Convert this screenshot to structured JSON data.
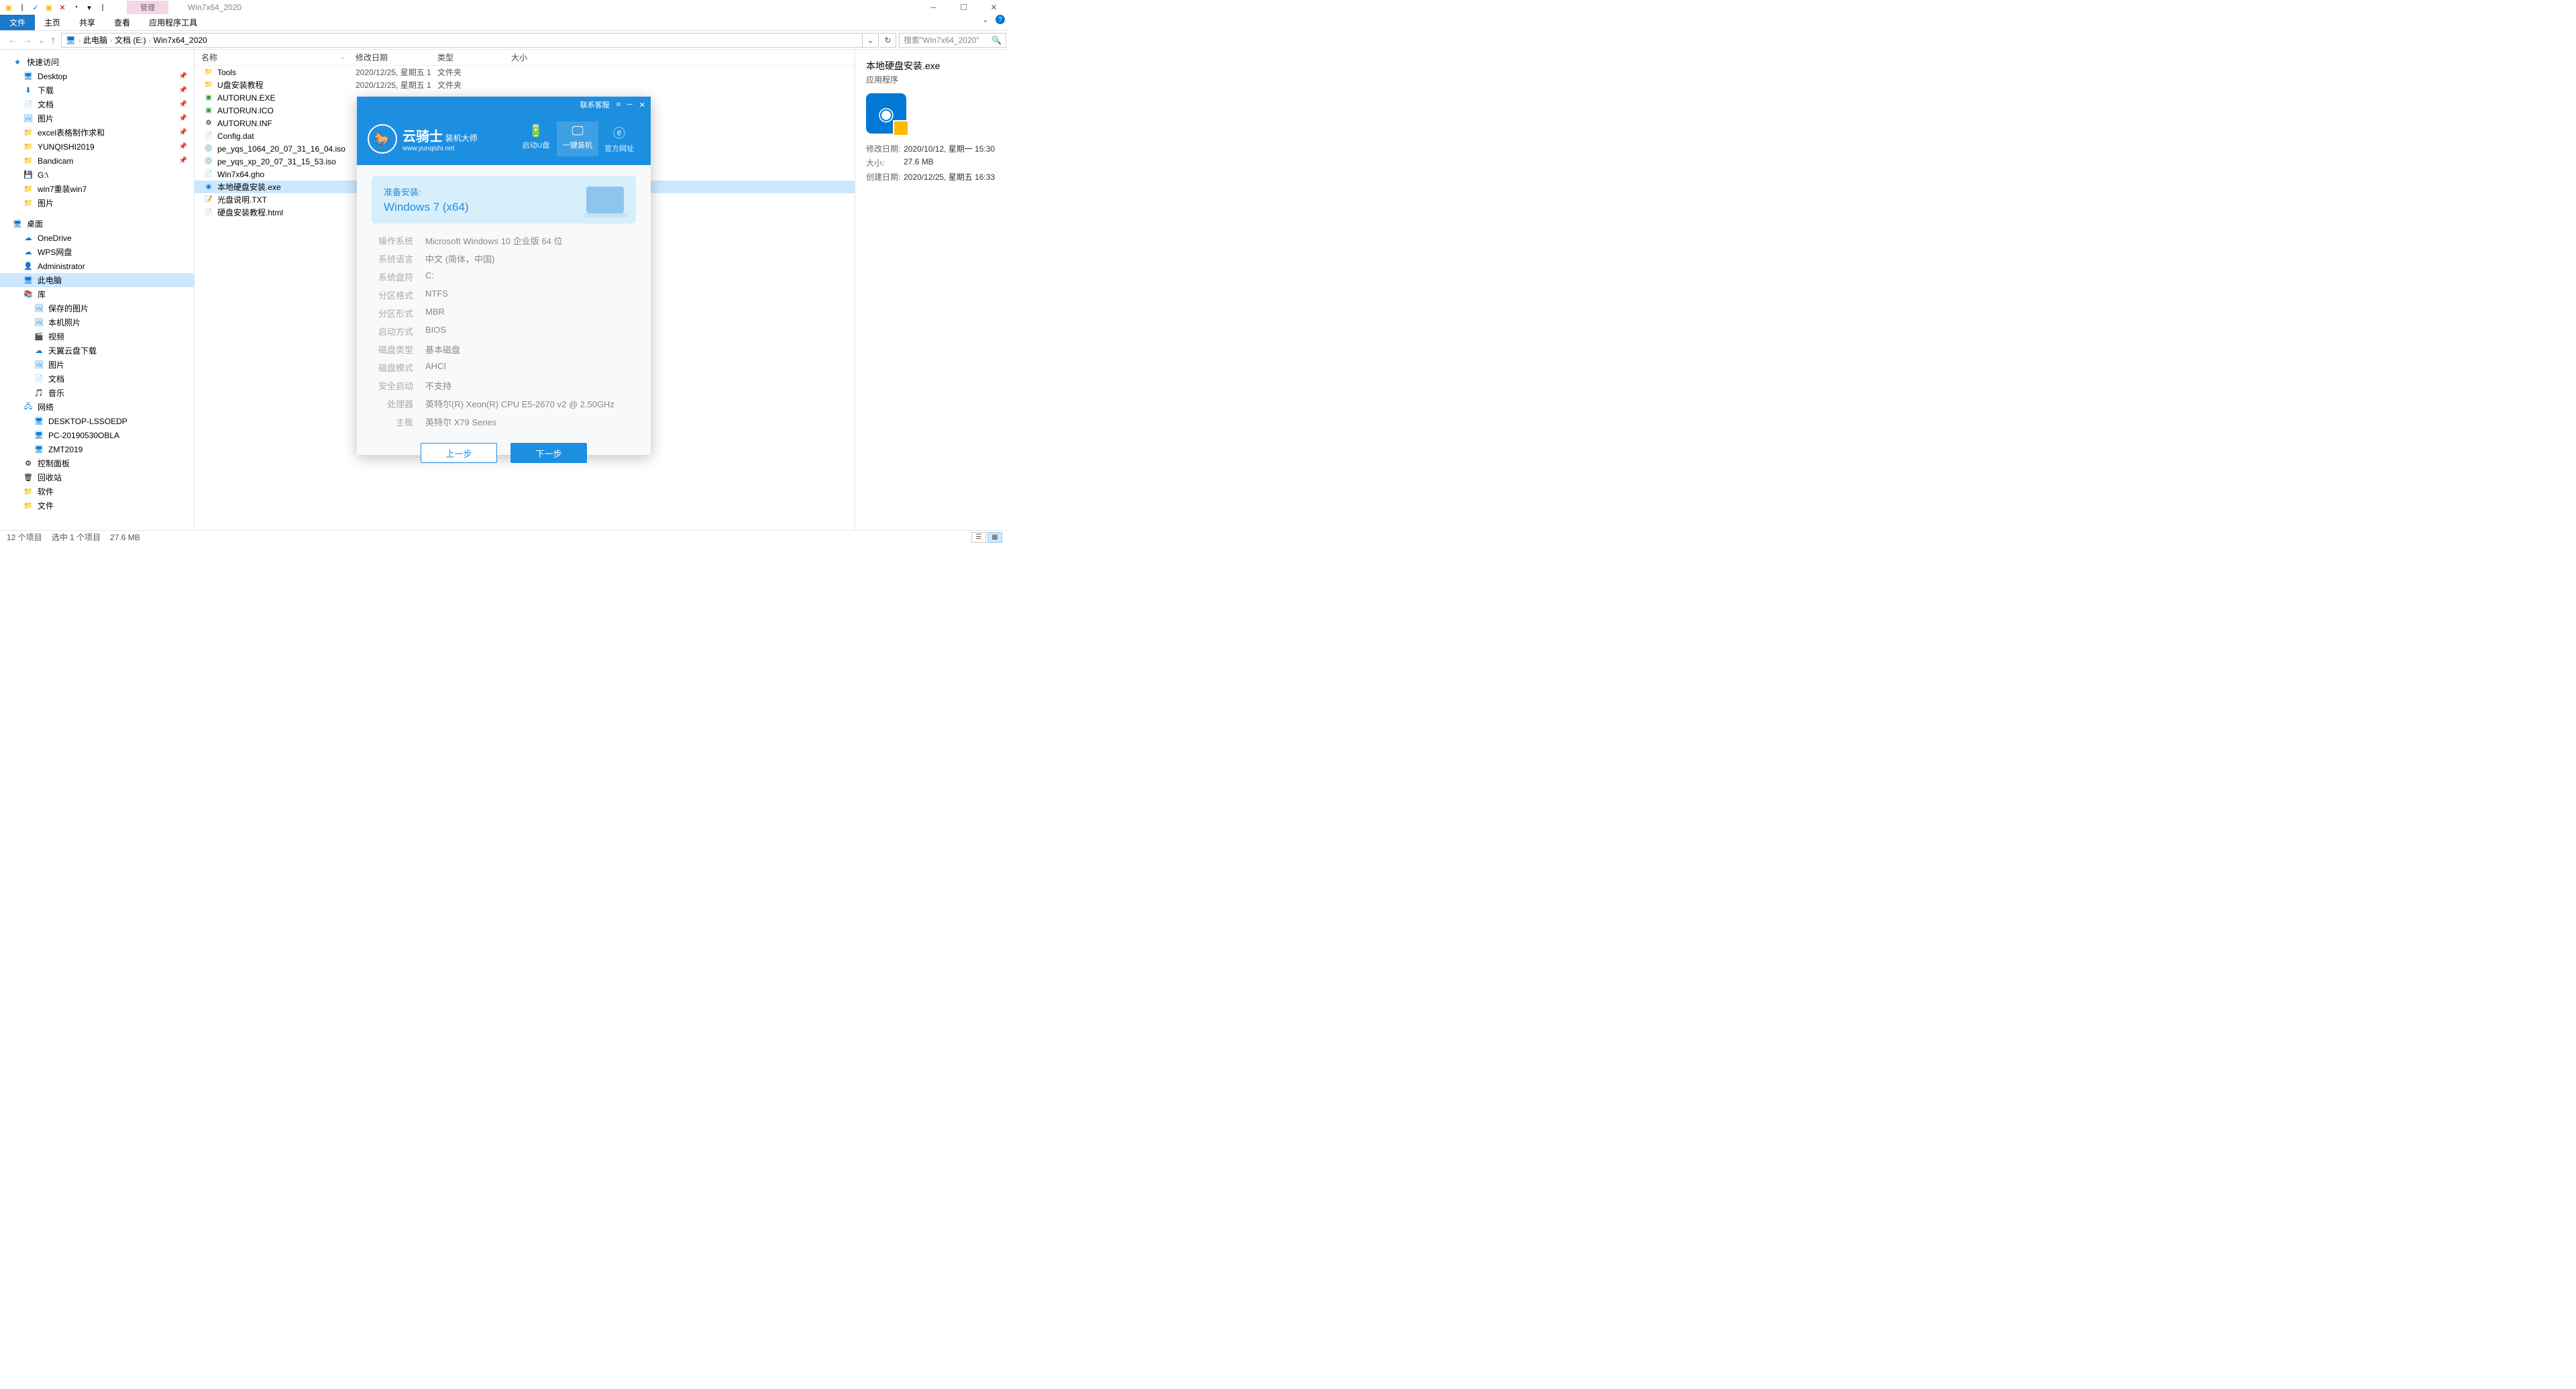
{
  "window": {
    "manage_tab": "管理",
    "title": "Win7x64_2020"
  },
  "ribbon": {
    "tabs": [
      "文件",
      "主页",
      "共享",
      "查看",
      "应用程序工具"
    ],
    "active": 0
  },
  "breadcrumbs": [
    "此电脑",
    "文档 (E:)",
    "Win7x64_2020"
  ],
  "search_placeholder": "搜索\"Win7x64_2020\"",
  "columns": {
    "name": "名称",
    "date": "修改日期",
    "type": "类型",
    "size": "大小"
  },
  "sidebar": {
    "quick": {
      "label": "快速访问",
      "items": [
        {
          "icon": "🖥",
          "iconClass": "blue-i",
          "label": "Desktop",
          "pin": true
        },
        {
          "icon": "⬇",
          "iconClass": "blue-i",
          "label": "下载",
          "pin": true
        },
        {
          "icon": "📄",
          "iconClass": "blue-i",
          "label": "文档",
          "pin": true
        },
        {
          "icon": "🖼",
          "iconClass": "blue-i",
          "label": "图片",
          "pin": true
        },
        {
          "icon": "📁",
          "iconClass": "folder-y",
          "label": "excel表格制作求和",
          "pin": true
        },
        {
          "icon": "📁",
          "iconClass": "folder-y",
          "label": "YUNQISHI2019",
          "pin": true
        },
        {
          "icon": "📁",
          "iconClass": "folder-y",
          "label": "Bandicam",
          "pin": true
        },
        {
          "icon": "💾",
          "iconClass": "",
          "label": "G:\\",
          "pin": false
        },
        {
          "icon": "📁",
          "iconClass": "folder-y",
          "label": "win7重装win7",
          "pin": false
        },
        {
          "icon": "📁",
          "iconClass": "folder-y",
          "label": "图片",
          "pin": false
        }
      ]
    },
    "desktop": {
      "label": "桌面",
      "items": [
        {
          "icon": "☁",
          "iconClass": "blue-i",
          "label": "OneDrive"
        },
        {
          "icon": "☁",
          "iconClass": "blue-i",
          "label": "WPS网盘"
        },
        {
          "icon": "👤",
          "iconClass": "",
          "label": "Administrator"
        },
        {
          "icon": "🖥",
          "iconClass": "blue-i",
          "label": "此电脑",
          "selected": true
        },
        {
          "icon": "📚",
          "iconClass": "folder-y",
          "label": "库"
        }
      ]
    },
    "libs": [
      {
        "icon": "🖼",
        "label": "保存的图片"
      },
      {
        "icon": "🖼",
        "label": "本机照片"
      },
      {
        "icon": "🎬",
        "label": "视频"
      },
      {
        "icon": "☁",
        "label": "天翼云盘下载"
      },
      {
        "icon": "🖼",
        "label": "图片"
      },
      {
        "icon": "📄",
        "label": "文档"
      },
      {
        "icon": "🎵",
        "label": "音乐"
      }
    ],
    "network": {
      "label": "网络",
      "items": [
        {
          "icon": "🖥",
          "label": "DESKTOP-LSSOEDP"
        },
        {
          "icon": "🖥",
          "label": "PC-20190530OBLA"
        },
        {
          "icon": "🖥",
          "label": "ZMT2019"
        }
      ]
    },
    "extras": [
      {
        "icon": "⚙",
        "label": "控制面板"
      },
      {
        "icon": "🗑",
        "label": "回收站"
      },
      {
        "icon": "📁",
        "iconClass": "folder-y",
        "label": "软件"
      },
      {
        "icon": "📁",
        "iconClass": "folder-y",
        "label": "文件"
      }
    ]
  },
  "files": [
    {
      "icon": "📁",
      "iconClass": "folder-y",
      "name": "Tools",
      "date": "2020/12/25, 星期五 1...",
      "type": "文件夹"
    },
    {
      "icon": "📁",
      "iconClass": "folder-y",
      "name": "U盘安装教程",
      "date": "2020/12/25, 星期五 1...",
      "type": "文件夹"
    },
    {
      "icon": "▣",
      "iconClass": "green-i",
      "name": "AUTORUN.EXE",
      "date": "",
      "type": ""
    },
    {
      "icon": "▣",
      "iconClass": "green-i",
      "name": "AUTORUN.ICO",
      "date": "",
      "type": ""
    },
    {
      "icon": "⚙",
      "iconClass": "",
      "name": "AUTORUN.INF",
      "date": "",
      "type": ""
    },
    {
      "icon": "📄",
      "iconClass": "",
      "name": "Config.dat",
      "date": "",
      "type": ""
    },
    {
      "icon": "💿",
      "iconClass": "",
      "name": "pe_yqs_1064_20_07_31_16_04.iso",
      "date": "",
      "type": ""
    },
    {
      "icon": "💿",
      "iconClass": "",
      "name": "pe_yqs_xp_20_07_31_15_53.iso",
      "date": "",
      "type": ""
    },
    {
      "icon": "📄",
      "iconClass": "",
      "name": "Win7x64.gho",
      "date": "",
      "type": ""
    },
    {
      "icon": "◉",
      "iconClass": "blue-i",
      "name": "本地硬盘安装.exe",
      "date": "",
      "type": "",
      "selected": true
    },
    {
      "icon": "📝",
      "iconClass": "",
      "name": "光盘说明.TXT",
      "date": "",
      "type": ""
    },
    {
      "icon": "📄",
      "iconClass": "",
      "name": "硬盘安装教程.html",
      "date": "",
      "type": ""
    }
  ],
  "details": {
    "title": "本地硬盘安装.exe",
    "subtype": "应用程序",
    "rows": [
      {
        "k": "修改日期:",
        "v": "2020/10/12, 星期一 15:30"
      },
      {
        "k": "大小:",
        "v": "27.6 MB"
      },
      {
        "k": "创建日期:",
        "v": "2020/12/25, 星期五 16:33"
      }
    ]
  },
  "status": {
    "count": "12 个项目",
    "selected": "选中 1 个项目",
    "size": "27.6 MB"
  },
  "installer": {
    "titlebar": {
      "support": "联系客服"
    },
    "logo": {
      "name": "云骑士",
      "sub1": "装机大师",
      "sub2": "www.yunqishi.net"
    },
    "nav": [
      {
        "icon": "🔋",
        "label": "启动U盘"
      },
      {
        "icon": "🖵",
        "label": "一键装机",
        "active": true
      },
      {
        "icon": "ⓔ",
        "label": "官方网址"
      }
    ],
    "prepare": {
      "title": "准备安装:",
      "os": "Windows 7 (x64)"
    },
    "specs": [
      {
        "k": "操作系统",
        "v": "Microsoft Windows 10 企业版 64 位"
      },
      {
        "k": "系统语言",
        "v": "中文 (简体，中国)"
      },
      {
        "k": "系统盘符",
        "v": "C:"
      },
      {
        "k": "分区格式",
        "v": "NTFS"
      },
      {
        "k": "分区形式",
        "v": "MBR"
      },
      {
        "k": "启动方式",
        "v": "BIOS"
      },
      {
        "k": "磁盘类型",
        "v": "基本磁盘"
      },
      {
        "k": "磁盘模式",
        "v": "AHCI"
      },
      {
        "k": "安全启动",
        "v": "不支持"
      },
      {
        "k": "处理器",
        "v": "英特尔(R) Xeon(R) CPU E5-2670 v2 @ 2.50GHz"
      },
      {
        "k": "主板",
        "v": "英特尔 X79 Series"
      }
    ],
    "buttons": {
      "prev": "上一步",
      "next": "下一步"
    }
  }
}
